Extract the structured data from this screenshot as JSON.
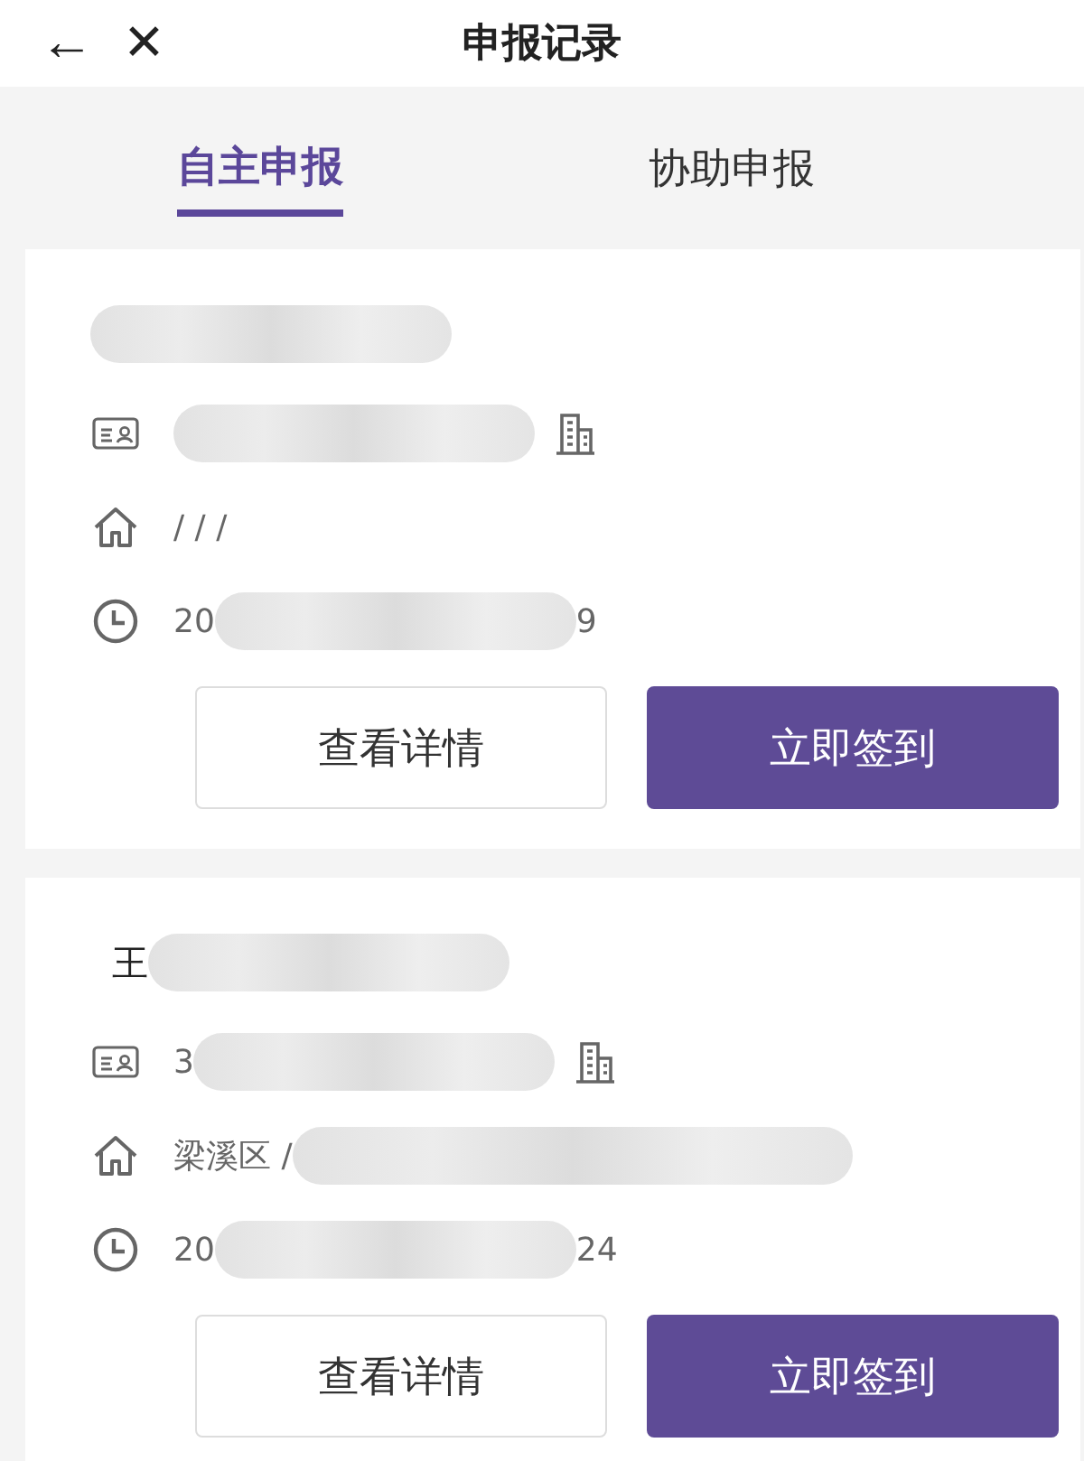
{
  "nav": {
    "back": "←",
    "close": "✕",
    "title": "申报记录"
  },
  "tabs": [
    {
      "label": "自主申报",
      "selected": true
    },
    {
      "label": "协助申报",
      "selected": false
    }
  ],
  "records": [
    {
      "name": {
        "redacted": true
      },
      "id_number": {
        "redacted": true
      },
      "address": {
        "text_before": "/ / /",
        "redacted": false
      },
      "time": {
        "text_before": "20",
        "redacted": true,
        "text_after": "9"
      },
      "buttons": [
        {
          "label": "查看详情",
          "kind": "outline"
        },
        {
          "label": "立即签到",
          "kind": "primary"
        }
      ]
    },
    {
      "name": {
        "text_before": "王",
        "redacted": true
      },
      "id_number": {
        "text_before": "3",
        "redacted": true
      },
      "address": {
        "text_before": "梁溪区 /",
        "redacted": true
      },
      "time": {
        "text_before": "20",
        "redacted": true,
        "text_after": "24"
      },
      "buttons": [
        {
          "label": "查看详情",
          "kind": "outline"
        },
        {
          "label": "立即签到",
          "kind": "primary"
        }
      ]
    }
  ]
}
